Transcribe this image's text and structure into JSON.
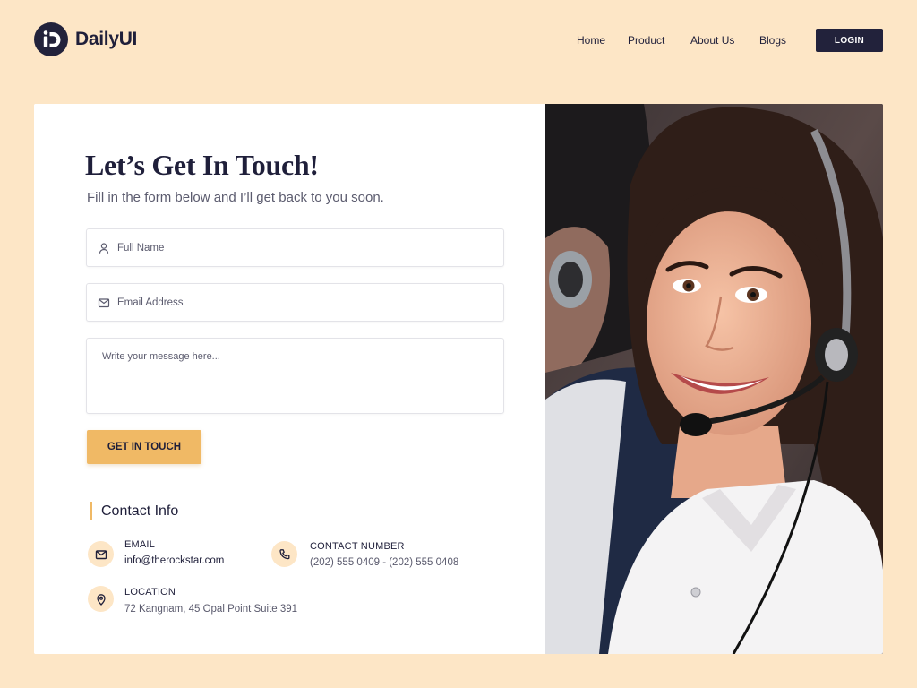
{
  "brand": {
    "name": "DailyUI"
  },
  "nav": {
    "items": [
      "Home",
      "Product",
      "About Us",
      "Blogs"
    ],
    "login": "LOGIN"
  },
  "hero": {
    "title": "Let’s Get In Touch!",
    "subtitle": "Fill in the form below and I’ll get back to you soon."
  },
  "form": {
    "name_placeholder": "Full Name",
    "email_placeholder": "Email Address",
    "message_placeholder": "Write your message here...",
    "submit_label": "GET IN TOUCH"
  },
  "contact": {
    "heading": "Contact Info",
    "email_label": "EMAIL",
    "email_value": "info@therockstar.com",
    "phone_label": "CONTACT NUMBER",
    "phone_value": "(202) 555 0409 - (202) 555 0408",
    "location_label": "LOCATION",
    "location_value": "72 Kangnam, 45 Opal Point Suite 391"
  },
  "icons": {
    "logo": "logo-d-icon",
    "name": "user-icon",
    "email": "mail-icon",
    "phone": "phone-icon",
    "location": "map-pin-icon"
  },
  "colors": {
    "background": "#fde6c6",
    "primary": "#22223b",
    "accent": "#f0b965",
    "muted": "#5b5b6e"
  }
}
